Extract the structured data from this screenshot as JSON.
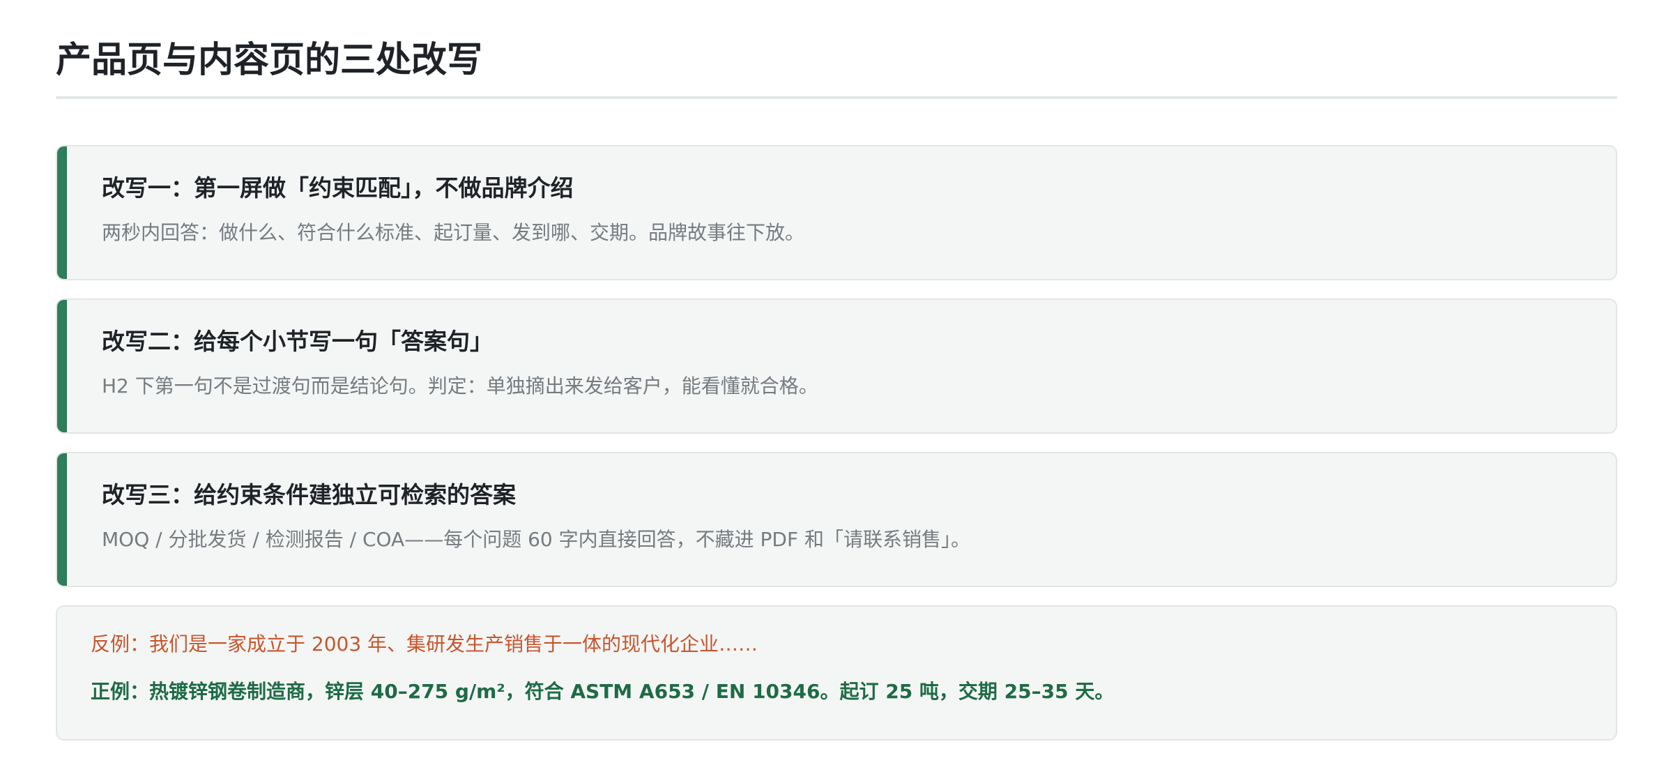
{
  "page": {
    "title": "产品页与内容页的三处改写"
  },
  "rewrites": [
    {
      "title": "改写一：第一屏做「约束匹配」，不做品牌介绍",
      "description": "两秒内回答：做什么、符合什么标准、起订量、发到哪、交期。品牌故事往下放。"
    },
    {
      "title": "改写二：给每个小节写一句「答案句」",
      "description": "H2 下第一句不是过渡句而是结论句。判定：单独摘出来发给客户，能看懂就合格。"
    },
    {
      "title": "改写三：给约束条件建独立可检索的答案",
      "description": "MOQ / 分批发货 / 检测报告 / COA——每个问题 60 字内直接回答，不藏进 PDF 和「请联系销售」。"
    }
  ],
  "examples": {
    "bad": "反例：我们是一家成立于 2003 年、集研发生产销售于一体的现代化企业……",
    "good": "正例：热镀锌钢卷制造商，锌层 40–275 g/m²，符合 ASTM A653 / EN 10346。起订 25 吨，交期 25–35 天。"
  },
  "colors": {
    "accent": "#2e7d5b",
    "bad_text": "#c8552d",
    "good_text": "#1e6b46",
    "card_background": "#f4f6f5"
  }
}
